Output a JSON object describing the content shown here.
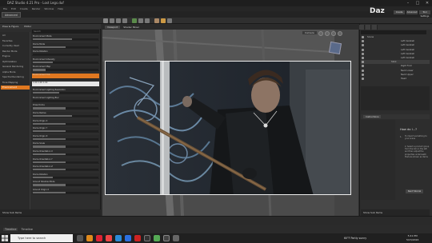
{
  "window": {
    "title": "DAZ Studio 4.21 Pro - Lost Legs.duf"
  },
  "menu": [
    "File",
    "Edit",
    "Create",
    "Render",
    "Window",
    "Help"
  ],
  "tabs": [
    "Advanced"
  ],
  "brand": {
    "logo": "Daz",
    "buttons": [
      "Create",
      "Advanced",
      "Tool Settings"
    ]
  },
  "left_panel": {
    "tabs": [
      "Pose & Figure",
      "Editor"
    ],
    "search_placeholder": "Search",
    "categories": [
      {
        "label": "All",
        "selected": false
      },
      {
        "label": "Favorites",
        "selected": false
      },
      {
        "label": "Currently Used",
        "selected": false
      },
      {
        "label": "Render Mode",
        "selected": false
      },
      {
        "label": "Engine",
        "selected": false
      },
      {
        "label": "Optimization",
        "selected": false
      },
      {
        "label": "General Rendering",
        "selected": false
      },
      {
        "label": "Alpha Mode",
        "selected": false
      },
      {
        "label": "Spectral Rendering",
        "selected": false
      },
      {
        "label": "Tone Mapping",
        "selected": false
      },
      {
        "label": "Environment",
        "selected": true
      }
    ],
    "properties": [
      {
        "label": "Environment Mode",
        "level": 0.6,
        "style": "normal"
      },
      {
        "label": "Dome Mode",
        "level": 0.5,
        "style": "normal"
      },
      {
        "label": "Dome Rotation",
        "level": 0.0,
        "style": "normal"
      },
      {
        "label": "Environment Intensity",
        "level": 0.3,
        "style": "normal"
      },
      {
        "label": "Environment Map",
        "level": 0.2,
        "style": "normal"
      },
      {
        "label": "Environment Tint",
        "level": 0.0,
        "style": "sel"
      },
      {
        "label": "1.00      1.00      1.00",
        "level": 0.0,
        "style": "white"
      },
      {
        "label": "Environment Lighting Resolution",
        "level": 0.4,
        "style": "normal"
      },
      {
        "label": "Environment Lighting Blur",
        "level": 0.0,
        "style": "normal"
      },
      {
        "label": "Draw Dome",
        "level": 0.5,
        "style": "normal"
      },
      {
        "label": "Dome Radius",
        "level": 0.6,
        "style": "normal"
      },
      {
        "label": "Dome Origin X",
        "level": 0.5,
        "style": "normal"
      },
      {
        "label": "Dome Origin Y",
        "level": 0.5,
        "style": "normal"
      },
      {
        "label": "Dome Origin Z",
        "level": 0.5,
        "style": "normal"
      },
      {
        "label": "Dome Scale",
        "level": 0.5,
        "style": "normal"
      },
      {
        "label": "Dome Orientation X",
        "level": 0.5,
        "style": "normal"
      },
      {
        "label": "Dome Orientation Y",
        "level": 0.5,
        "style": "normal"
      },
      {
        "label": "Dome Orientation Z",
        "level": 0.5,
        "style": "normal"
      },
      {
        "label": "Dome Rotation",
        "level": 0.3,
        "style": "normal"
      },
      {
        "label": "Ground Shadow Mode",
        "level": 0.5,
        "style": "normal"
      },
      {
        "label": "Ground Origin X",
        "level": 0.5,
        "style": "normal"
      }
    ],
    "bottom_label": "Show Sub Items"
  },
  "viewport": {
    "tabs": [
      "Viewport",
      "Shader Mixer"
    ],
    "camera_label": "Camera"
  },
  "scene": {
    "items": [
      {
        "label": "Scene",
        "selected": false
      },
      {
        "label": "Left Cerebell",
        "selected": false
      },
      {
        "label": "Left Cerebell",
        "selected": false
      },
      {
        "label": "Left Cerebell",
        "selected": false
      },
      {
        "label": "Left Cerebell",
        "selected": false
      },
      {
        "label": "Left Cerebell",
        "selected": false
      },
      {
        "label": "Stick",
        "selected": true
      },
      {
        "label": "Right Foot",
        "selected": false
      },
      {
        "label": "Neck Lower",
        "selected": false
      },
      {
        "label": "Neck Upper",
        "selected": false
      },
      {
        "label": "Head",
        "selected": false
      }
    ]
  },
  "lower_panel": {
    "tabs": [
      "Instructions"
    ]
  },
  "help": {
    "title": "How do I...?",
    "step_num": "1.",
    "steps": [
      "To import something to your scene",
      "2. Select a product group from the list on the left and then adjust the properties underneath that are shown as items"
    ],
    "next_label": "Next Tutorial",
    "bottom_label": "Show Sub Items"
  },
  "status": {
    "tabs": [
      "Timeline",
      "Timeline"
    ]
  },
  "taskbar": {
    "search_placeholder": "Type here to search",
    "weather": "60°F  Partly sunny",
    "time": "5:41 PM",
    "date": "5/15/2022"
  }
}
